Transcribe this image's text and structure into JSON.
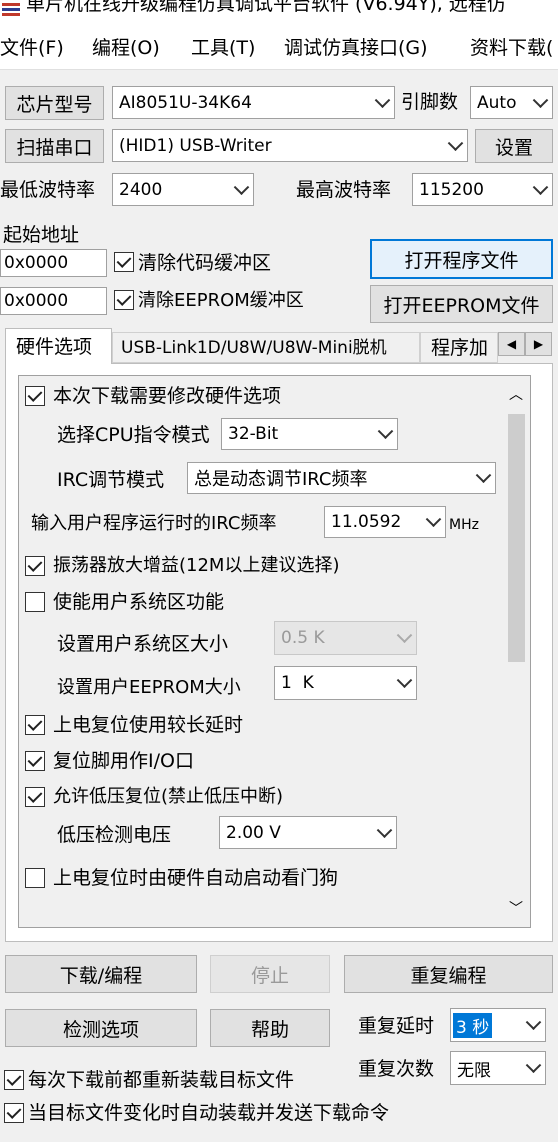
{
  "window": {
    "title": "单片机在线升级编程仿真调试平台软件 (V6.94Y), 远程仿"
  },
  "menu": [
    "文件(F)",
    "编程(O)",
    "工具(T)",
    "调试仿真接口(G)",
    "资料下载("
  ],
  "top": {
    "chip_button": "芯片型号",
    "chip_value": "AI8051U-34K64",
    "pins_label": "引脚数",
    "pins_value": "Auto",
    "scan_button": "扫描串口",
    "port_value": "(HID1) USB-Writer",
    "settings_button": "设置",
    "min_baud_label": "最低波特率",
    "min_baud_value": "2400",
    "max_baud_label": "最高波特率",
    "max_baud_value": "115200",
    "start_addr_label": "起始地址",
    "code_addr": "0x0000",
    "clear_code_label": "清除代码缓冲区",
    "clear_code_checked": true,
    "open_program_button": "打开程序文件",
    "eeprom_addr": "0x0000",
    "clear_eeprom_label": "清除EEPROM缓冲区",
    "clear_eeprom_checked": true,
    "open_eeprom_button": "打开EEPROM文件"
  },
  "tabs": [
    "硬件选项",
    "USB-Link1D/U8W/U8W-Mini脱机",
    "程序加"
  ],
  "hw": {
    "modify_label": "本次下载需要修改硬件选项",
    "modify_checked": true,
    "cpu_mode_label": "选择CPU指令模式",
    "cpu_mode_value": "32-Bit",
    "irc_mode_label": "IRC调节模式",
    "irc_mode_value": "总是动态调节IRC频率",
    "irc_freq_label": "输入用户程序运行时的IRC频率",
    "irc_freq_value": "11.0592",
    "irc_freq_unit": "MHz",
    "osc_gain_label": "振荡器放大增益(12M以上建议选择)",
    "osc_gain_checked": true,
    "user_sys_label": "使能用户系统区功能",
    "user_sys_checked": false,
    "user_sys_size_label": "设置用户系统区大小",
    "user_sys_size_value": "0.5 K",
    "user_eeprom_label": "设置用户EEPROM大小",
    "user_eeprom_value": "1  K",
    "power_delay_label": "上电复位使用较长延时",
    "power_delay_checked": true,
    "reset_io_label": "复位脚用作I/O口",
    "reset_io_checked": true,
    "lvr_label": "允许低压复位(禁止低压中断)",
    "lvr_checked": true,
    "lv_detect_label": "低压检测电压",
    "lv_detect_value": "2.00 V",
    "watchdog_label": "上电复位时由硬件自动启动看门狗",
    "watchdog_checked": false
  },
  "bottom": {
    "download_button": "下载/编程",
    "stop_button": "停止",
    "repeat_button": "重复编程",
    "detect_button": "检测选项",
    "help_button": "帮助",
    "repeat_delay_label": "重复延时",
    "repeat_delay_value": "3 秒",
    "repeat_count_label": "重复次数",
    "repeat_count_value": "无限",
    "reload_label": "每次下载前都重新装载目标文件",
    "reload_checked": true,
    "auto_load_label": "当目标文件变化时自动装载并发送下载命令",
    "auto_load_checked": true
  }
}
